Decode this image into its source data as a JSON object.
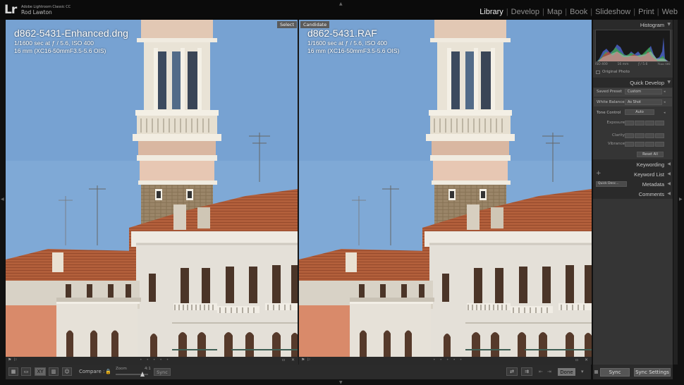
{
  "app": {
    "logo": "Lr",
    "product": "Adobe Lightroom Classic CC",
    "user": "Rod Lawton"
  },
  "modules": [
    "Library",
    "Develop",
    "Map",
    "Book",
    "Slideshow",
    "Print",
    "Web"
  ],
  "active_module": "Library",
  "compare": {
    "select": {
      "tag": "Select",
      "filename": "d862-5431-Enhanced.dng",
      "exposure": "1/1600 sec at ƒ / 5.6, ISO 400",
      "lens": "16 mm (XC16-50mmF3.5-5.6 OIS)"
    },
    "candidate": {
      "tag": "Candidate",
      "filename": "d862-5431.RAF",
      "exposure": "1/1600 sec at ƒ / 5.6, ISO 400",
      "lens": "16 mm (XC16-50mmF3.5-5.6 OIS)"
    }
  },
  "toolbar": {
    "compare_label": "Compare :",
    "zoom_label": "Zoom",
    "zoom_value": "4:1",
    "sync_label": "Sync",
    "done_label": "Done"
  },
  "panels": {
    "histogram": {
      "title": "Histogram",
      "iso": "ISO 400",
      "focal": "16 mm",
      "aperture": "ƒ / 5.6",
      "shutter": "¹⁄₁₆₀₀ sec",
      "original_photo_label": "Original Photo"
    },
    "quick_develop": {
      "title": "Quick Develop",
      "saved_preset_label": "Saved Preset",
      "saved_preset_value": "Custom",
      "white_balance_label": "White Balance",
      "white_balance_value": "As Shot",
      "tone_control_label": "Tone Control",
      "auto_label": "Auto",
      "exposure_label": "Exposure",
      "clarity_label": "Clarity",
      "vibrance_label": "Vibrance",
      "reset_label": "Reset All"
    },
    "keywording": {
      "title": "Keywording"
    },
    "keyword_list": {
      "title": "Keyword List"
    },
    "metadata": {
      "title": "Metadata",
      "preset": "Quick Desc..."
    },
    "comments": {
      "title": "Comments"
    }
  },
  "syncbar": {
    "sync_label": "Sync",
    "sync_settings_label": "Sync Settings"
  },
  "colors": {
    "sky": "#7fa9d6",
    "roof": "#b5643e",
    "tower": "#e9e3d6",
    "panel": "#353535"
  }
}
